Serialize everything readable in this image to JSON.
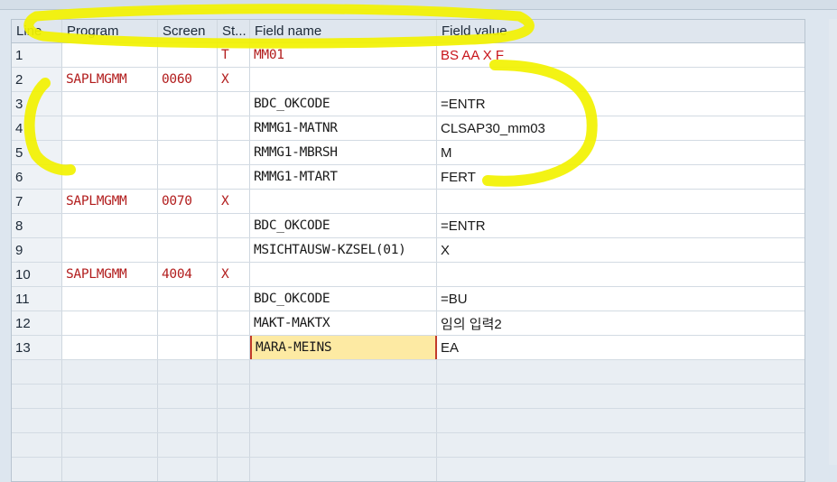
{
  "table": {
    "columns": [
      "Line",
      "Program",
      "Screen",
      "St...",
      "Field name",
      "Field value"
    ],
    "rows": [
      {
        "line": "1",
        "program": "",
        "screen": "",
        "st": "T",
        "field_name": "MM01",
        "field_value": "BS AA X   F"
      },
      {
        "line": "2",
        "program": "SAPLMGMM",
        "screen": "0060",
        "st": "X",
        "field_name": "",
        "field_value": ""
      },
      {
        "line": "3",
        "program": "",
        "screen": "",
        "st": "",
        "field_name": "BDC_OKCODE",
        "field_value": "=ENTR"
      },
      {
        "line": "4",
        "program": "",
        "screen": "",
        "st": "",
        "field_name": "RMMG1-MATNR",
        "field_value": "CLSAP30_mm03"
      },
      {
        "line": "5",
        "program": "",
        "screen": "",
        "st": "",
        "field_name": "RMMG1-MBRSH",
        "field_value": "M"
      },
      {
        "line": "6",
        "program": "",
        "screen": "",
        "st": "",
        "field_name": "RMMG1-MTART",
        "field_value": "FERT"
      },
      {
        "line": "7",
        "program": "SAPLMGMM",
        "screen": "0070",
        "st": "X",
        "field_name": "",
        "field_value": ""
      },
      {
        "line": "8",
        "program": "",
        "screen": "",
        "st": "",
        "field_name": "BDC_OKCODE",
        "field_value": "=ENTR"
      },
      {
        "line": "9",
        "program": "",
        "screen": "",
        "st": "",
        "field_name": "MSICHTAUSW-KZSEL(01)",
        "field_value": "X"
      },
      {
        "line": "10",
        "program": "SAPLMGMM",
        "screen": "4004",
        "st": "X",
        "field_name": "",
        "field_value": ""
      },
      {
        "line": "11",
        "program": "",
        "screen": "",
        "st": "",
        "field_name": "BDC_OKCODE",
        "field_value": "=BU"
      },
      {
        "line": "12",
        "program": "",
        "screen": "",
        "st": "",
        "field_name": "MAKT-MAKTX",
        "field_value": "임의 입력2"
      },
      {
        "line": "13",
        "program": "",
        "screen": "",
        "st": "",
        "field_name": "MARA-MEINS",
        "field_value": "EA"
      }
    ]
  },
  "colors": {
    "red_text": "#b21d1d",
    "highlighter": "#f2f200",
    "selected_cell": "#fdeaa3"
  }
}
